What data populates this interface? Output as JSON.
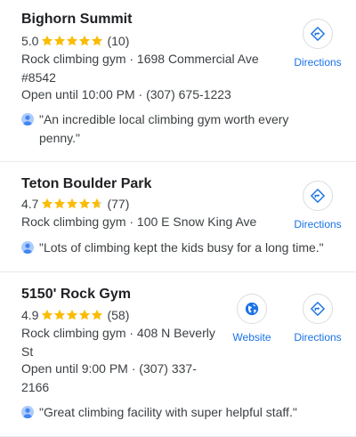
{
  "results": [
    {
      "name": "Bighorn Summit",
      "rating": "5.0",
      "star_fill": [
        1,
        1,
        1,
        1,
        1
      ],
      "reviews": "(10)",
      "info_line_1": "Rock climbing gym · 1698 Commercial Ave",
      "info_line_2": "#8542",
      "hours": "Open until 10:00 PM · (307) 675-1223",
      "review_line_1": "\"An incredible local climbing gym worth every",
      "review_line_2": "penny.\"",
      "directions_label": "Directions"
    },
    {
      "name": "Teton Boulder Park",
      "rating": "4.7",
      "star_fill": [
        1,
        1,
        1,
        1,
        0.7
      ],
      "reviews": "(77)",
      "info_line_1": "Rock climbing gym · 100 E Snow King Ave",
      "review_line_1": "\"Lots of climbing kept the kids busy for a long time.\"",
      "directions_label": "Directions"
    },
    {
      "name": "5150' Rock Gym",
      "rating": "4.9",
      "star_fill": [
        1,
        1,
        1,
        1,
        1
      ],
      "reviews": "(58)",
      "info_line_1": "Rock climbing gym · 408 N Beverly",
      "info_line_2": "St",
      "hours_line_1": "Open until 9:00 PM · (307) 337-",
      "hours_line_2": "2166",
      "review_line_1": "\"Great climbing facility with super helpful staff.\"",
      "website_label": "Website",
      "directions_label": "Directions"
    }
  ],
  "colors": {
    "star": "#fbbc04",
    "star_empty": "#dadce0",
    "accent": "#1a73e8"
  },
  "icons": {
    "directions": "directions-icon",
    "website": "globe-icon",
    "reviewer": "person-avatar-icon"
  }
}
